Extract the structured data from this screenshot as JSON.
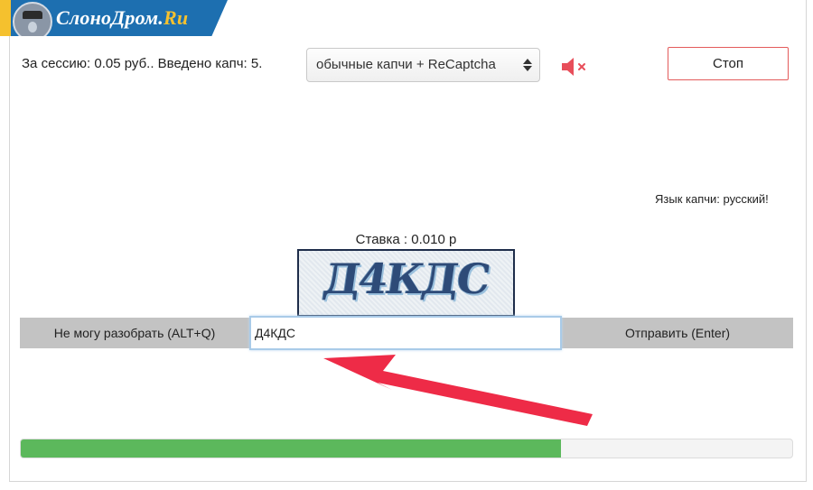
{
  "logo": {
    "text_main": "СлоноДром.",
    "text_suffix": "Ru"
  },
  "session": {
    "info": "За сессию: 0.05 руб.. Введено капч: 5."
  },
  "mode_select": {
    "selected": "обычные капчи + ReCaptcha"
  },
  "icons": {
    "mute": "speaker-muted-icon",
    "arrow": "red-arrow-annotation"
  },
  "colors": {
    "accent_red": "#e84e5a",
    "progress_green": "#5cb85c",
    "logo_blue": "#1d6fb0",
    "logo_yellow": "#f5c12e"
  },
  "stop_button": {
    "label": "Стоп"
  },
  "captcha": {
    "language": "Язык капчи: русский!",
    "rate": "Ставка : 0.010 р",
    "image_text": "Д4КДС"
  },
  "actions": {
    "cant_solve_label": "Не могу разобрать (ALT+Q)",
    "answer_value": "Д4КДС",
    "send_label": "Отправить (Enter)"
  },
  "progress": {
    "value_percent": 70
  }
}
